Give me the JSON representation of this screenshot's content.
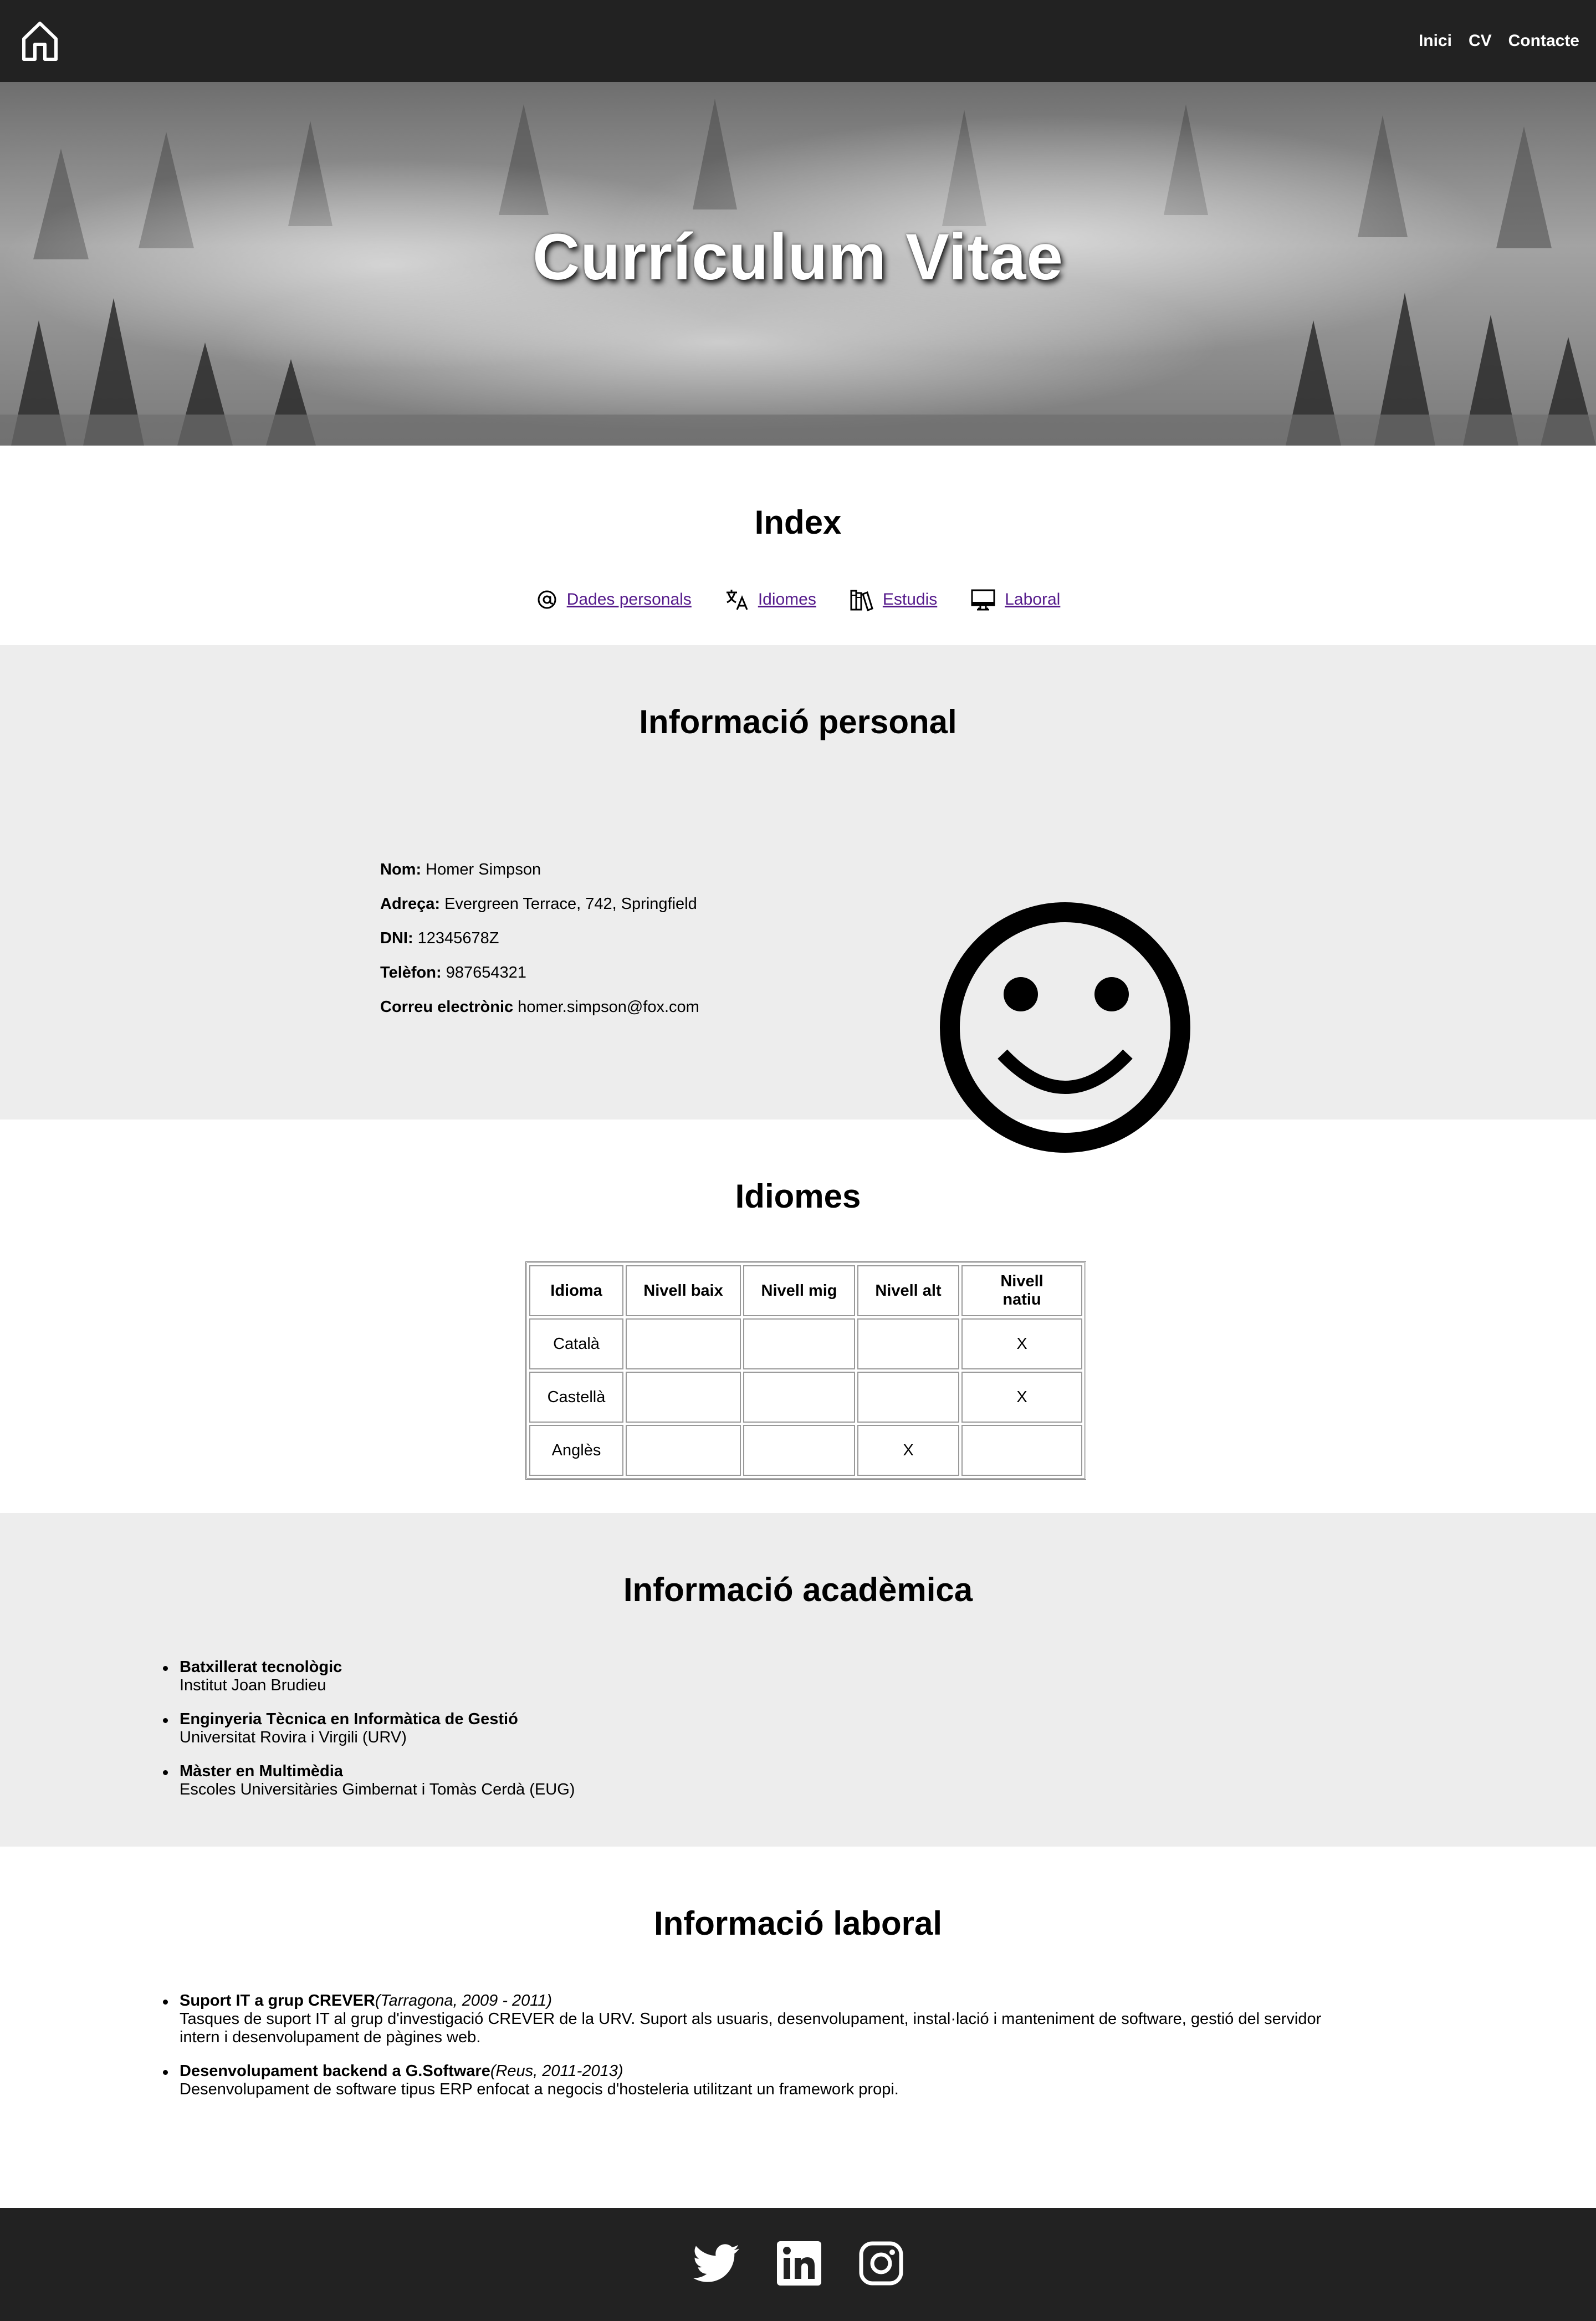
{
  "nav": {
    "home_icon": "home-icon",
    "links": [
      "Inici",
      "CV",
      "Contacte"
    ]
  },
  "hero": {
    "title": "Currículum Vitae"
  },
  "index": {
    "title": "Index",
    "links": [
      {
        "icon": "at-icon",
        "label": "Dades personals"
      },
      {
        "icon": "translate-icon",
        "label": "Idiomes"
      },
      {
        "icon": "books-icon",
        "label": "Estudis"
      },
      {
        "icon": "monitor-icon",
        "label": "Laboral"
      }
    ]
  },
  "personal": {
    "title": "Informació personal",
    "fields": [
      {
        "label": "Nom:",
        "value": "Homer Simpson"
      },
      {
        "label": "Adreça:",
        "value": "Evergreen Terrace, 742, Springfield"
      },
      {
        "label": "DNI:",
        "value": "12345678Z"
      },
      {
        "label": "Telèfon:",
        "value": "987654321"
      },
      {
        "label": "Correu electrònic",
        "value": "homer.simpson@fox.com"
      }
    ],
    "photo_icon": "smiley-icon"
  },
  "languages": {
    "title": "Idiomes",
    "headers": [
      "Idioma",
      "Nivell baix",
      "Nivell mig",
      "Nivell alt",
      "Nivell natiu"
    ],
    "rows": [
      [
        "Català",
        "",
        "",
        "",
        "X"
      ],
      [
        "Castellà",
        "",
        "",
        "",
        "X"
      ],
      [
        "Anglès",
        "",
        "",
        "X",
        ""
      ]
    ]
  },
  "academic": {
    "title": "Informació acadèmica",
    "items": [
      {
        "degree": "Batxillerat tecnològic",
        "school": "Institut Joan Brudieu"
      },
      {
        "degree": "Enginyeria Tècnica en Informàtica de Gestió",
        "school": "Universitat Rovira i Virgili (URV)"
      },
      {
        "degree": "Màster en Multimèdia",
        "school": "Escoles Universitàries Gimbernat i Tomàs Cerdà (EUG)"
      }
    ]
  },
  "work": {
    "title": "Informació laboral",
    "items": [
      {
        "position": "Suport IT a grup CREVER",
        "meta": "(Tarragona, 2009 - 2011)",
        "description": "Tasques de suport IT al grup d'investigació CREVER de la URV. Suport als usuaris, desenvolupament, instal·lació i manteniment de software, gestió del servidor intern i desenvolupament de pàgines web."
      },
      {
        "position": "Desenvolupament backend a G.Software",
        "meta": "(Reus, 2011-2013)",
        "description": "Desenvolupament de software tipus ERP enfocat a negocis d'hosteleria utilitzant un framework propi."
      }
    ]
  },
  "footer": {
    "social_icons": [
      "twitter-icon",
      "linkedin-icon",
      "instagram-icon"
    ]
  }
}
